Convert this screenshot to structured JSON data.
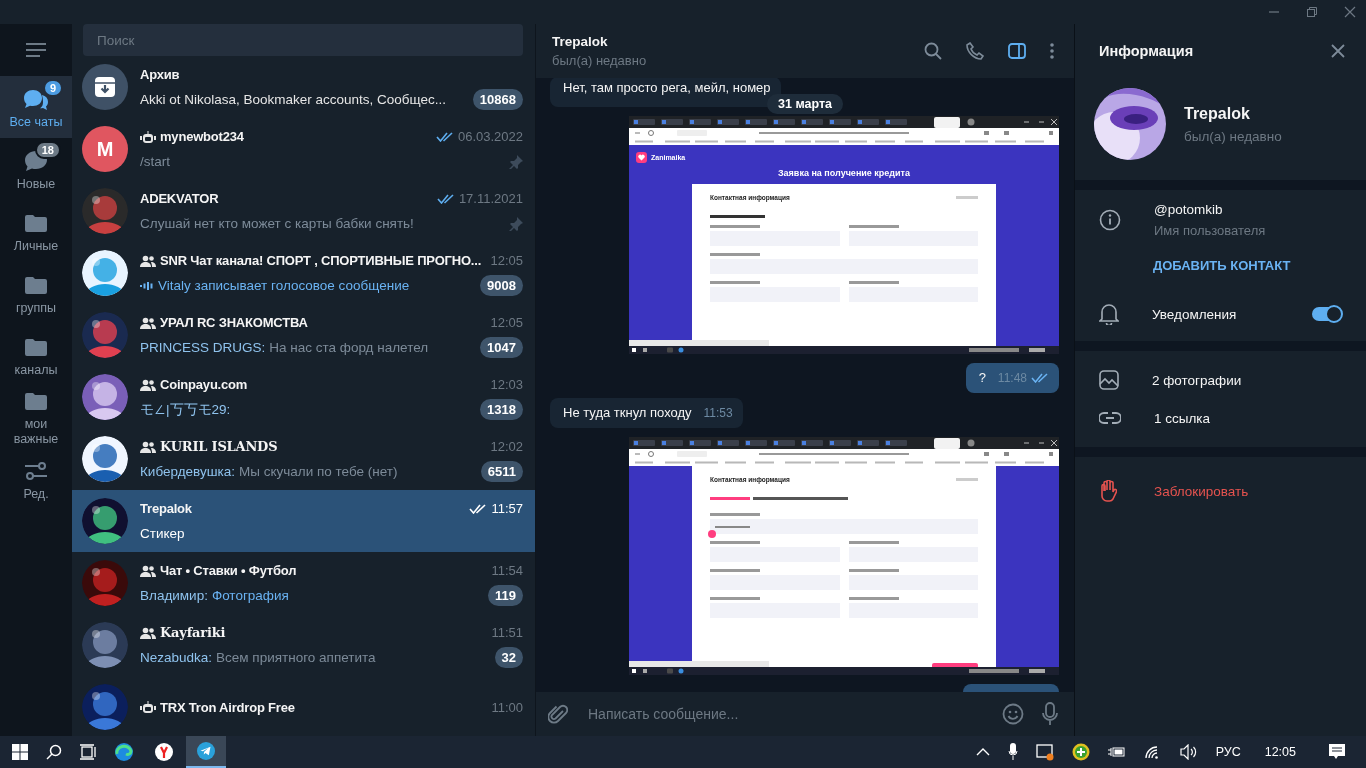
{
  "folders": [
    {
      "label": "Все чаты",
      "badge": "9",
      "kind": "chats",
      "selected": true
    },
    {
      "label": "Новые",
      "badge": "18",
      "kind": "chat",
      "selected": false
    },
    {
      "label": "Личные",
      "kind": "folder",
      "selected": false
    },
    {
      "label": "группы",
      "kind": "folder",
      "selected": false
    },
    {
      "label": "каналы",
      "kind": "folder",
      "selected": false
    },
    {
      "label": "мои важные",
      "kind": "folder",
      "selected": false
    },
    {
      "label": "Ред.",
      "kind": "edit",
      "selected": false
    }
  ],
  "search": {
    "placeholder": "Поиск"
  },
  "chats": [
    {
      "name": "Архив",
      "kind": "archive",
      "preview": "Akki ot Nikolasa, Bookmaker accounts, Сообщес...",
      "accent": false,
      "typing": false,
      "count": "10868",
      "selected": false
    },
    {
      "name": "mynewbot234",
      "kind": "bot",
      "avatar_letter": "M",
      "time": "06.03.2022",
      "read": true,
      "preview": "/start",
      "accent": false,
      "typing": false,
      "pinned": true,
      "selected": false
    },
    {
      "name": "ADEKVATOR",
      "kind": "user",
      "time": "17.11.2021",
      "read": true,
      "preview": "Слушай нет кто может с карты бабки  снять!",
      "accent": false,
      "typing": false,
      "pinned": true,
      "selected": false
    },
    {
      "name": "SNR Чат канала! СПОРТ , СПОРТИВНЫЕ ПРОГНО...",
      "kind": "group",
      "time": "12:05",
      "preview": "Vitaly записывает голосовое сообщение",
      "accent": false,
      "typing": true,
      "count": "9008",
      "selected": false
    },
    {
      "name": "УРАЛ RC ЗНАКОМСТВА",
      "kind": "group",
      "time": "12:05",
      "sender": "PRINCESS DRUGS:",
      "preview": "На нас ста форд налетел",
      "accent": false,
      "typing": false,
      "count": "1047",
      "selected": false
    },
    {
      "name": "Coinpayu.com",
      "kind": "group",
      "time": "12:03",
      "sender": "モ∠|丂丂モ29:",
      "count": "1318",
      "selected": false
    },
    {
      "name": "KURIL ISLANDS",
      "kind": "group",
      "time": "12:02",
      "sender": "Кибердевушка:",
      "preview": "Мы скучали по тебе (нет)",
      "accent": false,
      "typing": false,
      "count": "6511",
      "selected": false
    },
    {
      "name": "Trepalok",
      "kind": "user",
      "time": "11:57",
      "read": true,
      "preview": "Стикер",
      "accent": false,
      "typing": false,
      "selected": true
    },
    {
      "name": "Чат • Ставки • Футбол",
      "kind": "group",
      "time": "11:54",
      "sender": "Владимир:",
      "preview": "Фотография",
      "accent": true,
      "typing": false,
      "count": "119",
      "selected": false
    },
    {
      "name": "Kayfariki",
      "kind": "group",
      "time": "11:51",
      "sender": "Nezabudka:",
      "preview": "Всем приятного аппетита",
      "accent": false,
      "typing": false,
      "count": "32",
      "selected": false
    },
    {
      "name": "TRX Tron Airdrop Free",
      "kind": "bot",
      "time": "11:00",
      "selected": false
    }
  ],
  "chat": {
    "title": "Trepalok",
    "status": "был(а) недавно",
    "date": "31 марта",
    "messages": [
      {
        "kind": "text",
        "outgoing": false,
        "text": "Нет, там просто рега, мейл, номер"
      },
      {
        "kind": "screenshot",
        "outgoing": true,
        "screenshot": {
          "brand": "Zanimaika",
          "heading": "Заявка на получение кредита",
          "form_title": "Контактная информация",
          "fields": [
            {
              "kind": "section"
            },
            {
              "kind": "input",
              "wide": false
            },
            {
              "kind": "input",
              "wide": false
            },
            {
              "kind": "input",
              "wide": true
            },
            {
              "kind": "input",
              "wide": false
            },
            {
              "kind": "input",
              "wide": false
            }
          ]
        }
      },
      {
        "kind": "text",
        "outgoing": true,
        "text": "?",
        "time": "11:48",
        "read": true
      },
      {
        "kind": "text",
        "outgoing": false,
        "text": "Не туда ткнул походу",
        "time": "11:53"
      },
      {
        "kind": "screenshot",
        "outgoing": true,
        "screenshot": {
          "form_title": "Контактная информация",
          "submit": true,
          "fields": [
            {
              "kind": "note"
            },
            {
              "kind": "range",
              "wide": true
            },
            {
              "kind": "input",
              "wide": false
            },
            {
              "kind": "input",
              "wide": false
            },
            {
              "kind": "input",
              "wide": false
            },
            {
              "kind": "input",
              "wide": false
            },
            {
              "kind": "input",
              "wide": false
            },
            {
              "kind": "input",
              "wide": false
            }
          ]
        }
      },
      {
        "kind": "partial",
        "outgoing": true
      }
    ],
    "composer": {
      "placeholder": "Написать сообщение..."
    }
  },
  "info": {
    "title": "Информация",
    "name": "Trepalok",
    "status": "был(а) недавно",
    "username": "@potomkib",
    "username_label": "Имя пользователя",
    "add_contact": "ДОБАВИТЬ КОНТАКТ",
    "notifications": {
      "label": "Уведомления",
      "on": true
    },
    "media": [
      {
        "kind": "photos",
        "label": "2 фотографии"
      },
      {
        "kind": "links",
        "label": "1 ссылка"
      }
    ],
    "block": "Заблокировать"
  },
  "taskbar": {
    "language": "РУС",
    "clock": "12:05"
  }
}
